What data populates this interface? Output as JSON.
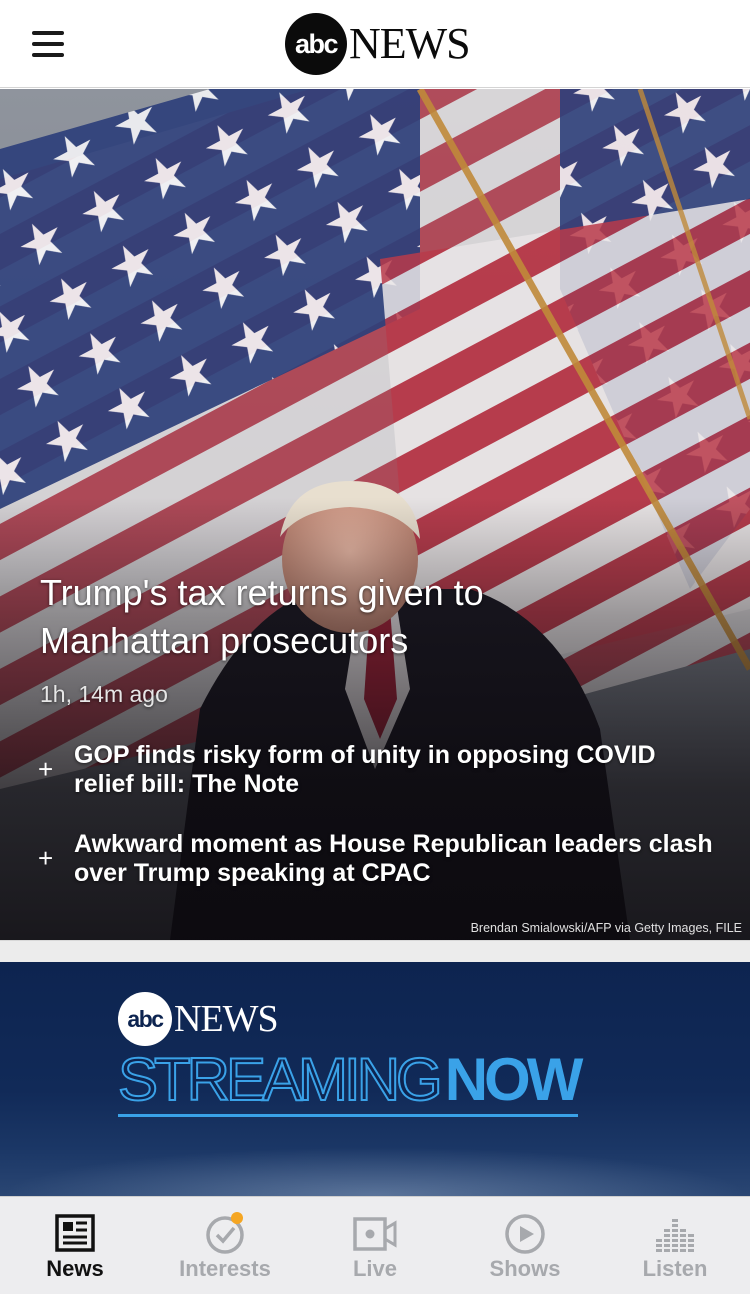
{
  "header": {
    "logo_circle_text": "abc",
    "logo_word": "NEWS",
    "menu_icon": "hamburger-menu-icon"
  },
  "hero": {
    "headline": "Trump's tax returns given to Manhattan prosecutors",
    "timestamp": "1h, 14m ago",
    "related": [
      {
        "icon": "plus-icon",
        "symbol": "+",
        "title": "GOP finds risky form of unity in opposing COVID relief bill: The Note"
      },
      {
        "icon": "plus-icon",
        "symbol": "+",
        "title": "Awkward moment as House Republican leaders clash over Trump speaking at CPAC"
      }
    ],
    "photo_credit": "Brendan Smialowski/AFP via Getty Images, FILE"
  },
  "streaming_banner": {
    "circle_text": "abc",
    "news_word": "NEWS",
    "streaming_word": "STREAMING",
    "now_word": "NOW",
    "accent_color": "#3aa2e8",
    "background_color": "#0d2450"
  },
  "tab_bar": {
    "tabs": [
      {
        "label": "News",
        "icon": "newspaper-icon",
        "active": true
      },
      {
        "label": "Interests",
        "icon": "checkmark-circle-icon",
        "active": false,
        "badge": true
      },
      {
        "label": "Live",
        "icon": "video-camera-icon",
        "active": false
      },
      {
        "label": "Shows",
        "icon": "play-circle-icon",
        "active": false
      },
      {
        "label": "Listen",
        "icon": "equalizer-icon",
        "active": false
      }
    ],
    "active_color": "#111111",
    "inactive_color": "#a7a9ad",
    "badge_color": "#f5a623"
  }
}
